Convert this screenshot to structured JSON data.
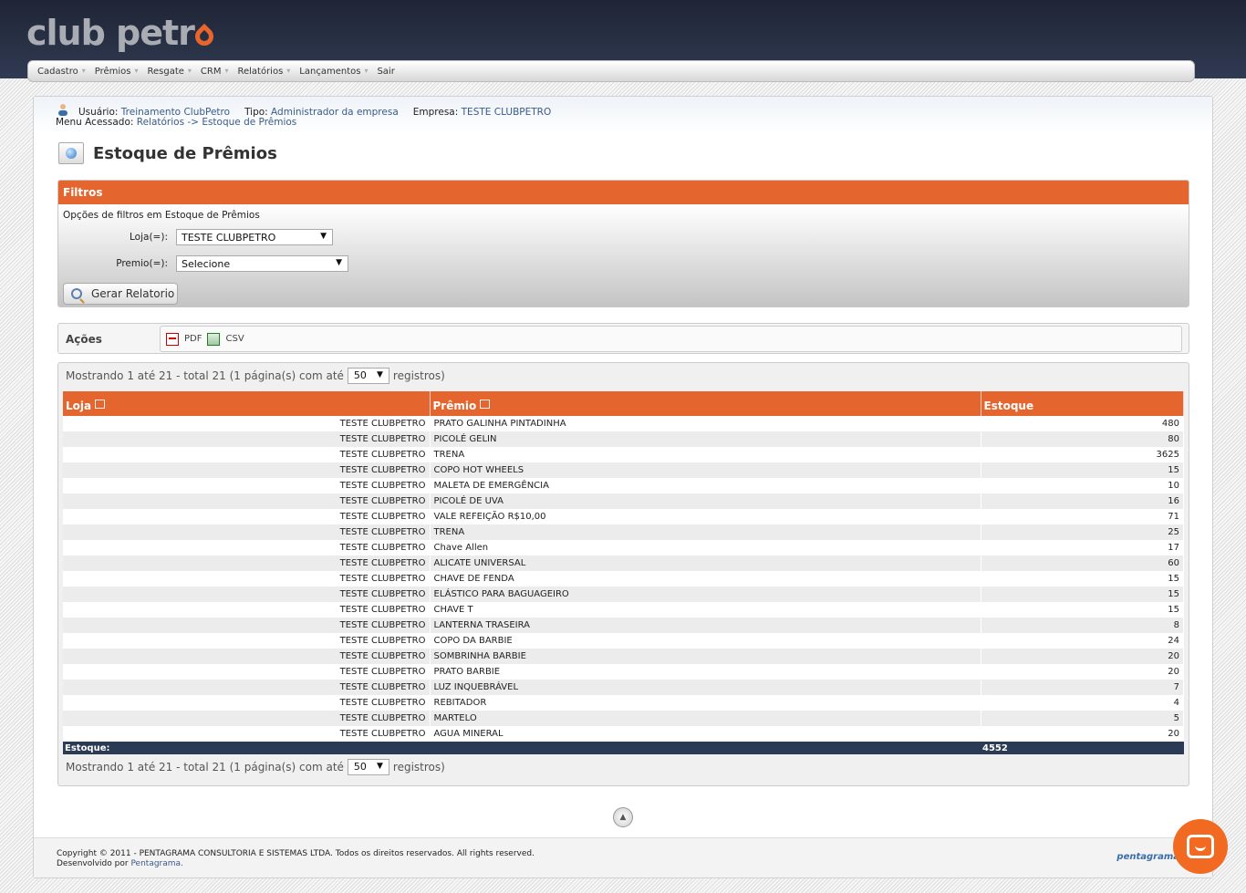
{
  "brand": {
    "name": "club petr",
    "accent": "#e5652f",
    "dark": "#2b3a55"
  },
  "menu": [
    {
      "label": "Cadastro"
    },
    {
      "label": "Prêmios"
    },
    {
      "label": "Resgate"
    },
    {
      "label": "CRM"
    },
    {
      "label": "Relatórios"
    },
    {
      "label": "Lançamentos"
    },
    {
      "label": "Sair"
    }
  ],
  "user": {
    "usuario_label": "Usuário:",
    "usuario": "Treinamento ClubPetro",
    "tipo_label": "Tipo:",
    "tipo": "Administrador da empresa",
    "empresa_label": "Empresa:",
    "empresa": "TESTE CLUBPETRO",
    "menu_label": "Menu Acessado:",
    "menu_path": "Relatórios -> Estoque de Prêmios"
  },
  "page_title": "Estoque de Prêmios",
  "filters": {
    "header": "Filtros",
    "subtitle": "Opções de filtros em Estoque de Prêmios",
    "loja_label": "Loja(=):",
    "loja_value": "TESTE CLUBPETRO",
    "premio_label": "Premio(=):",
    "premio_value": "Selecione",
    "button": "Gerar Relatorio"
  },
  "acoes": {
    "label": "Ações",
    "pdf": "PDF",
    "csv": "CSV"
  },
  "pager": {
    "prefix": "Mostrando 1 até 21 - total 21 (1 página(s) com até",
    "per_page": "50",
    "suffix": "registros)"
  },
  "table": {
    "headers": [
      "Loja",
      "Prêmio",
      "Estoque"
    ],
    "rows": [
      [
        "TESTE CLUBPETRO",
        "PRATO GALINHA PINTADINHA",
        "480"
      ],
      [
        "TESTE CLUBPETRO",
        "PICOLÉ GELIN",
        "80"
      ],
      [
        "TESTE CLUBPETRO",
        "TRENA",
        "3625"
      ],
      [
        "TESTE CLUBPETRO",
        "COPO HOT WHEELS",
        "15"
      ],
      [
        "TESTE CLUBPETRO",
        "MALETA DE EMERGÊNCIA",
        "10"
      ],
      [
        "TESTE CLUBPETRO",
        "PICOLÉ DE UVA",
        "16"
      ],
      [
        "TESTE CLUBPETRO",
        "VALE REFEIÇÃO R$10,00",
        "71"
      ],
      [
        "TESTE CLUBPETRO",
        "TRENA",
        "25"
      ],
      [
        "TESTE CLUBPETRO",
        "Chave Allen",
        "17"
      ],
      [
        "TESTE CLUBPETRO",
        "ALICATE UNIVERSAL",
        "60"
      ],
      [
        "TESTE CLUBPETRO",
        "CHAVE DE FENDA",
        "15"
      ],
      [
        "TESTE CLUBPETRO",
        "ELÁSTICO PARA BAGUAGEIRO",
        "15"
      ],
      [
        "TESTE CLUBPETRO",
        "CHAVE T",
        "15"
      ],
      [
        "TESTE CLUBPETRO",
        "LANTERNA TRASEIRA",
        "8"
      ],
      [
        "TESTE CLUBPETRO",
        "COPO DA BARBIE",
        "24"
      ],
      [
        "TESTE CLUBPETRO",
        "SOMBRINHA BARBIE",
        "20"
      ],
      [
        "TESTE CLUBPETRO",
        "PRATO BARBIE",
        "20"
      ],
      [
        "TESTE CLUBPETRO",
        "LUZ INQUEBRÁVEL",
        "7"
      ],
      [
        "TESTE CLUBPETRO",
        "REBITADOR",
        "4"
      ],
      [
        "TESTE CLUBPETRO",
        "MARTELO",
        "5"
      ],
      [
        "TESTE CLUBPETRO",
        "AGUA MINERAL",
        "20"
      ]
    ],
    "total_label": "Estoque:",
    "total_value": "4552"
  },
  "footer": {
    "copyright": "Copyright © 2011 - PENTAGRAMA CONSULTORIA E SISTEMAS LTDA. Todos os direitos reservados. All rights reserved.",
    "dev_prefix": "Desenvolvido por",
    "dev_name": "Pentagrama.",
    "logo": "pentagrama"
  },
  "icons": [
    "user-icon",
    "page-icon",
    "magnifier-icon",
    "pdf-icon",
    "csv-icon",
    "sort-icon",
    "scroll-top-icon",
    "chat-icon"
  ]
}
